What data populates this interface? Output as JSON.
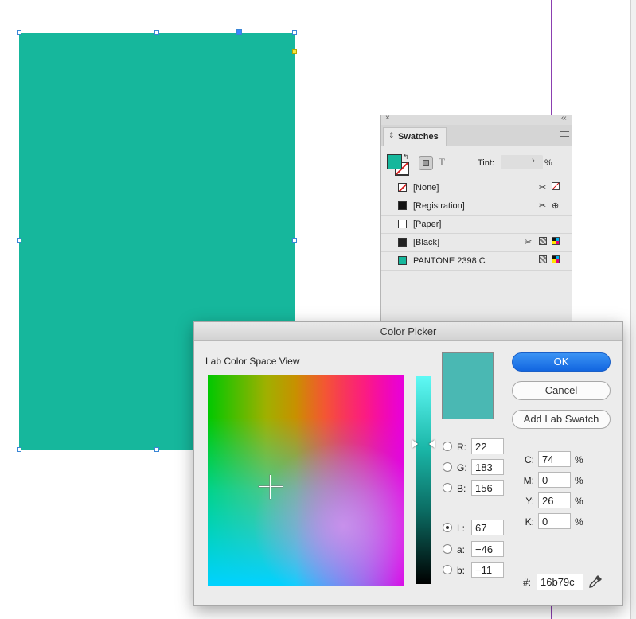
{
  "document": {
    "shape_fill_color": "#16b79c",
    "guide_color": "#8b3fb0"
  },
  "swatches_panel": {
    "tab_label": "Swatches",
    "close_glyph": "×",
    "collapse_glyph": "‹‹",
    "tab_icon_glyph": "⇕",
    "text_glyph": "T",
    "tint_label": "Tint:",
    "tint_value": "",
    "tint_arrow": "›",
    "tint_unit": "%",
    "fill_color": "#16b79c",
    "items": [
      {
        "name": "[None]",
        "chip": "none",
        "icons": [
          "edit-lock-icon",
          "none-type-icon"
        ]
      },
      {
        "name": "[Registration]",
        "chip": "#111111",
        "icons": [
          "edit-lock-icon",
          "registration-type-icon"
        ]
      },
      {
        "name": "[Paper]",
        "chip": "#ffffff",
        "icons": []
      },
      {
        "name": "[Black]",
        "chip": "#222222",
        "icons": [
          "edit-lock-icon",
          "process-color-icon",
          "cmyk-mode-icon"
        ]
      },
      {
        "name": "PANTONE 2398 C",
        "chip": "#16b79c",
        "icons": [
          "process-color-icon",
          "cmyk-mode-icon"
        ]
      }
    ]
  },
  "color_picker": {
    "title": "Color Picker",
    "view_label": "Lab Color Space View",
    "preview_color": "#4ab8b3",
    "selected_channel": "L",
    "rgb": [
      {
        "label": "R:",
        "value": "22"
      },
      {
        "label": "G:",
        "value": "183"
      },
      {
        "label": "B:",
        "value": "156"
      }
    ],
    "lab": [
      {
        "label": "L:",
        "value": "67"
      },
      {
        "label": "a:",
        "value": "−46"
      },
      {
        "label": "b:",
        "value": "−11"
      }
    ],
    "cmyk": [
      {
        "label": "C:",
        "value": "74",
        "unit": "%"
      },
      {
        "label": "M:",
        "value": "0",
        "unit": "%"
      },
      {
        "label": "Y:",
        "value": "26",
        "unit": "%"
      },
      {
        "label": "K:",
        "value": "0",
        "unit": "%"
      }
    ],
    "hex_label": "#:",
    "hex_value": "16b79c",
    "buttons": {
      "ok": "OK",
      "cancel": "Cancel",
      "add_lab_swatch": "Add Lab Swatch"
    }
  }
}
